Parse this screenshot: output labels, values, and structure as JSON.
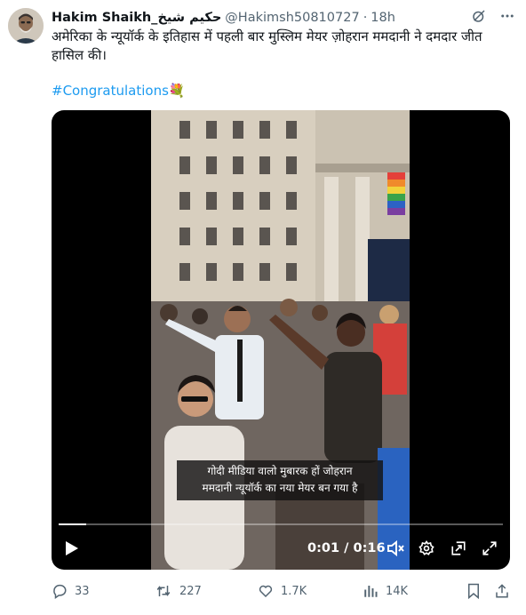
{
  "tweet": {
    "display_name": "Hakim Shaikh_حكيم شيخ",
    "handle": "@Hakimsh50810727",
    "separator": "·",
    "time": "18h",
    "text": "अमेरिका के न्यूयॉर्क के इतिहास में पहली बार मुस्लिम मेयर ज़ोहरान ममदानी ने दमदार जीत हासिल की।",
    "hashtag": "#Congratulations",
    "hashtag_emoji": "💐",
    "link_color": "#1d9bf0",
    "grok_icon": "grok-icon",
    "more_icon": "more-icon"
  },
  "video": {
    "subtitle_line1": "गोदी मीडिया वालो मुबारक हों जोहरान",
    "subtitle_line2": "ममदानी न्यूयॉर्क का नया मेयर बन गया है",
    "current_time": "0:01",
    "time_separator": "/",
    "duration": "0:16",
    "progress_fraction": 0.0625,
    "play_icon": "play-icon",
    "volume_icon": "muted-icon",
    "settings_icon": "gear-icon",
    "pip_icon": "picture-in-picture-icon",
    "fullscreen_icon": "fullscreen-icon"
  },
  "actions": {
    "replies": "33",
    "reposts": "227",
    "likes": "1.7K",
    "views": "14K",
    "reply_icon": "reply-icon",
    "repost_icon": "repost-icon",
    "like_icon": "heart-icon",
    "views_icon": "views-icon",
    "bookmark_icon": "bookmark-icon",
    "share_icon": "share-icon"
  }
}
